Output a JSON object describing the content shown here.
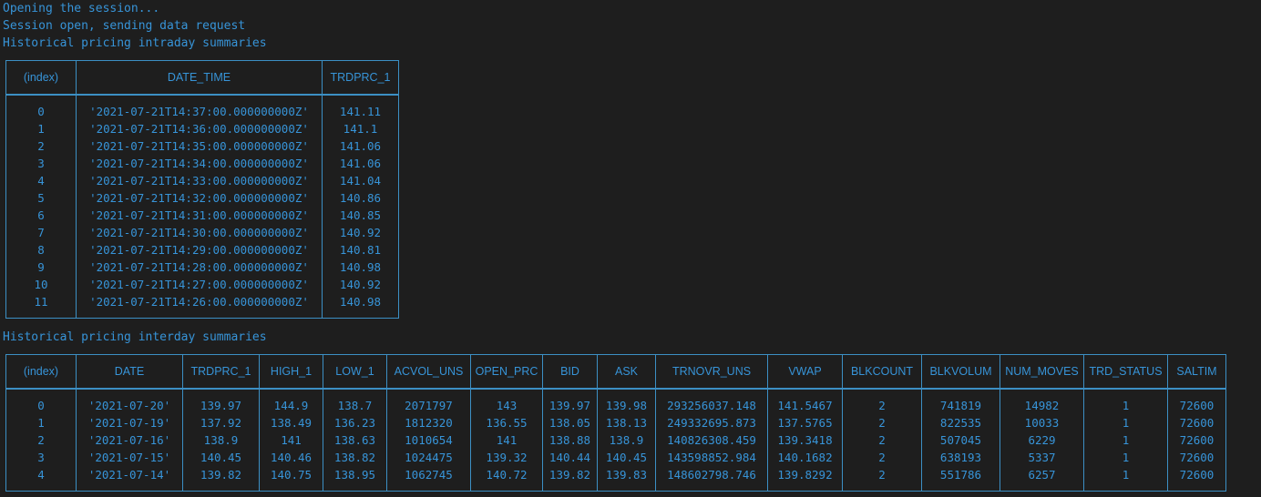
{
  "console": {
    "lines": [
      "Opening the session...",
      "Session open, sending data request",
      "Historical pricing intraday summaries"
    ],
    "interday_title": "Historical pricing interday summaries"
  },
  "intraday": {
    "columns": [
      "(index)",
      "DATE_TIME",
      "TRDPRC_1"
    ],
    "rows": [
      [
        "0",
        "'2021-07-21T14:37:00.000000000Z'",
        "141.11"
      ],
      [
        "1",
        "'2021-07-21T14:36:00.000000000Z'",
        "141.1"
      ],
      [
        "2",
        "'2021-07-21T14:35:00.000000000Z'",
        "141.06"
      ],
      [
        "3",
        "'2021-07-21T14:34:00.000000000Z'",
        "141.06"
      ],
      [
        "4",
        "'2021-07-21T14:33:00.000000000Z'",
        "141.04"
      ],
      [
        "5",
        "'2021-07-21T14:32:00.000000000Z'",
        "140.86"
      ],
      [
        "6",
        "'2021-07-21T14:31:00.000000000Z'",
        "140.85"
      ],
      [
        "7",
        "'2021-07-21T14:30:00.000000000Z'",
        "140.92"
      ],
      [
        "8",
        "'2021-07-21T14:29:00.000000000Z'",
        "140.81"
      ],
      [
        "9",
        "'2021-07-21T14:28:00.000000000Z'",
        "140.98"
      ],
      [
        "10",
        "'2021-07-21T14:27:00.000000000Z'",
        "140.92"
      ],
      [
        "11",
        "'2021-07-21T14:26:00.000000000Z'",
        "140.98"
      ]
    ]
  },
  "interday": {
    "columns": [
      "(index)",
      "DATE",
      "TRDPRC_1",
      "HIGH_1",
      "LOW_1",
      "ACVOL_UNS",
      "OPEN_PRC",
      "BID",
      "ASK",
      "TRNOVR_UNS",
      "VWAP",
      "BLKCOUNT",
      "BLKVOLUM",
      "NUM_MOVES",
      "TRD_STATUS",
      "SALTIM"
    ],
    "rows": [
      [
        "0",
        "'2021-07-20'",
        "139.97",
        "144.9",
        "138.7",
        "2071797",
        "143",
        "139.97",
        "139.98",
        "293256037.148",
        "141.5467",
        "2",
        "741819",
        "14982",
        "1",
        "72600"
      ],
      [
        "1",
        "'2021-07-19'",
        "137.92",
        "138.49",
        "136.23",
        "1812320",
        "136.55",
        "138.05",
        "138.13",
        "249332695.873",
        "137.5765",
        "2",
        "822535",
        "10033",
        "1",
        "72600"
      ],
      [
        "2",
        "'2021-07-16'",
        "138.9",
        "141",
        "138.63",
        "1010654",
        "141",
        "138.88",
        "138.9",
        "140826308.459",
        "139.3418",
        "2",
        "507045",
        "6229",
        "1",
        "72600"
      ],
      [
        "3",
        "'2021-07-15'",
        "140.45",
        "140.46",
        "138.82",
        "1024475",
        "139.32",
        "140.44",
        "140.45",
        "143598852.984",
        "140.1682",
        "2",
        "638193",
        "5337",
        "1",
        "72600"
      ],
      [
        "4",
        "'2021-07-14'",
        "139.82",
        "140.75",
        "138.95",
        "1062745",
        "140.72",
        "139.82",
        "139.83",
        "148602798.746",
        "139.8292",
        "2",
        "551786",
        "6257",
        "1",
        "72600"
      ]
    ]
  }
}
